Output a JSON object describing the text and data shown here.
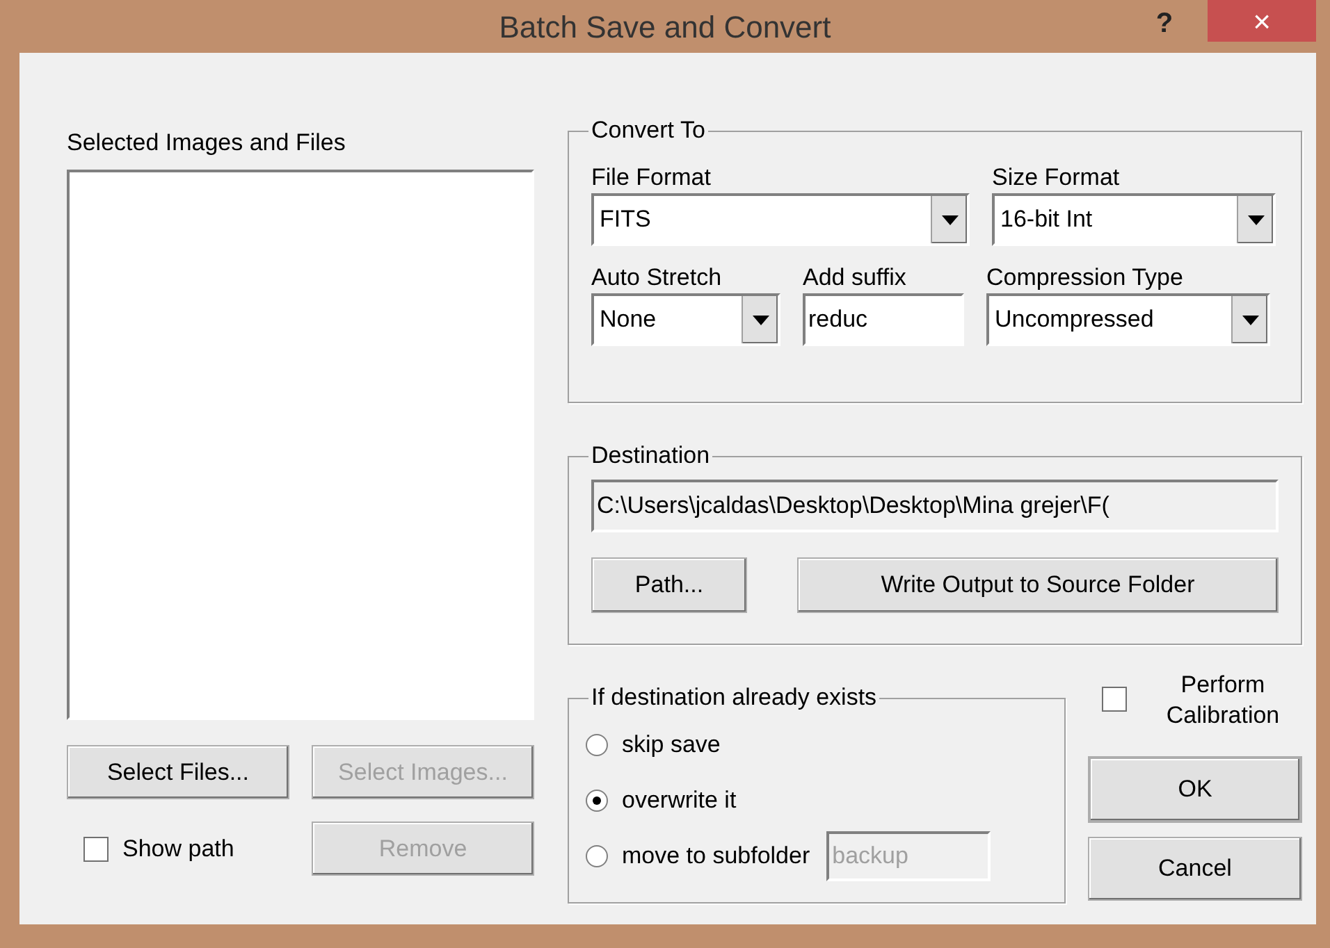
{
  "window": {
    "title": "Batch Save and Convert",
    "help": "?",
    "close": "×"
  },
  "files": {
    "label": "Selected Images and Files",
    "buttons": [
      {
        "label": "Select Files...",
        "disabled": false
      },
      {
        "label": "Select Images...",
        "disabled": true
      }
    ],
    "show_path": {
      "label": "Show path",
      "checked": false
    },
    "remove": {
      "label": "Remove",
      "disabled": true
    }
  },
  "convert_to": {
    "title": "Convert To",
    "fields": [
      {
        "kind": "select",
        "label": "File Format",
        "value": "FITS"
      },
      {
        "kind": "select",
        "label": "Size Format",
        "value": "16-bit Int"
      },
      {
        "kind": "select",
        "label": "Auto Stretch",
        "value": "None"
      },
      {
        "kind": "input",
        "label": "Add suffix",
        "value": "reduc"
      },
      {
        "kind": "select",
        "label": "Compression Type",
        "value": "Uncompressed"
      }
    ]
  },
  "destination": {
    "title": "Destination",
    "path": "C:\\Users\\jcaldas\\Desktop\\Desktop\\Mina grejer\\F(",
    "buttons": [
      "Path...",
      "Write Output to Source Folder"
    ]
  },
  "if_exists": {
    "title": "If destination already exists",
    "options": [
      {
        "label": "skip save",
        "selected": false
      },
      {
        "label": "overwrite it",
        "selected": true
      },
      {
        "label": "move to subfolder",
        "selected": false
      }
    ],
    "subfolder": {
      "value": "backup",
      "disabled": true
    }
  },
  "perform_calibration": {
    "label": "Perform Calibration",
    "checked": false
  },
  "ok": "OK",
  "cancel": "Cancel"
}
